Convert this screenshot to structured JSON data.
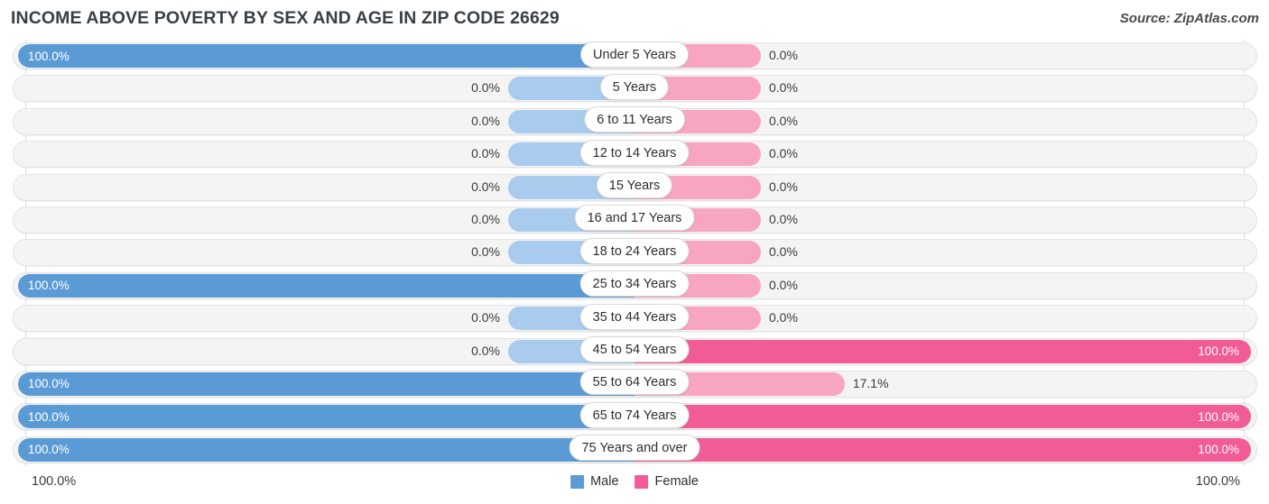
{
  "header": {
    "title": "INCOME ABOVE POVERTY BY SEX AND AGE IN ZIP CODE 26629",
    "source": "Source: ZipAtlas.com"
  },
  "legend": {
    "male_label": "Male",
    "female_label": "Female",
    "male_color": "#5b9bd5",
    "female_color": "#f25c96"
  },
  "axis": {
    "left_label": "100.0%",
    "right_label": "100.0%"
  },
  "colors": {
    "male_full": "#5b9bd5",
    "male_zero": "#a8cbee",
    "female_full": "#f25c96",
    "female_zero": "#f8a5c2",
    "track": "#f4f4f4",
    "track_border": "#e3e3e3",
    "grid": "#dcdcdc"
  },
  "chart_data": {
    "type": "bar",
    "title": "INCOME ABOVE POVERTY BY SEX AND AGE IN ZIP CODE 26629",
    "subtitle": "",
    "xlabel": "",
    "ylabel": "",
    "orientation": "horizontal",
    "style": "diverging-bidirectional-bar",
    "xlim": [
      0,
      100
    ],
    "grid": true,
    "legend_position": "bottom-center",
    "axis_ticks": [
      "100.0%",
      "100.0%"
    ],
    "categories": [
      "Under 5 Years",
      "5 Years",
      "6 to 11 Years",
      "12 to 14 Years",
      "15 Years",
      "16 and 17 Years",
      "18 to 24 Years",
      "25 to 34 Years",
      "35 to 44 Years",
      "45 to 54 Years",
      "55 to 64 Years",
      "65 to 74 Years",
      "75 Years and over"
    ],
    "series": [
      {
        "name": "Male",
        "color": "#5b9bd5",
        "values": [
          100.0,
          0.0,
          0.0,
          0.0,
          0.0,
          0.0,
          0.0,
          100.0,
          0.0,
          0.0,
          100.0,
          100.0,
          100.0
        ],
        "labels": [
          "100.0%",
          "0.0%",
          "0.0%",
          "0.0%",
          "0.0%",
          "0.0%",
          "0.0%",
          "100.0%",
          "0.0%",
          "0.0%",
          "100.0%",
          "100.0%",
          "100.0%"
        ]
      },
      {
        "name": "Female",
        "color": "#f25c96",
        "values": [
          0.0,
          0.0,
          0.0,
          0.0,
          0.0,
          0.0,
          0.0,
          0.0,
          0.0,
          100.0,
          17.1,
          100.0,
          100.0
        ],
        "labels": [
          "0.0%",
          "0.0%",
          "0.0%",
          "0.0%",
          "0.0%",
          "0.0%",
          "0.0%",
          "0.0%",
          "0.0%",
          "100.0%",
          "17.1%",
          "100.0%",
          "100.0%"
        ]
      }
    ]
  }
}
